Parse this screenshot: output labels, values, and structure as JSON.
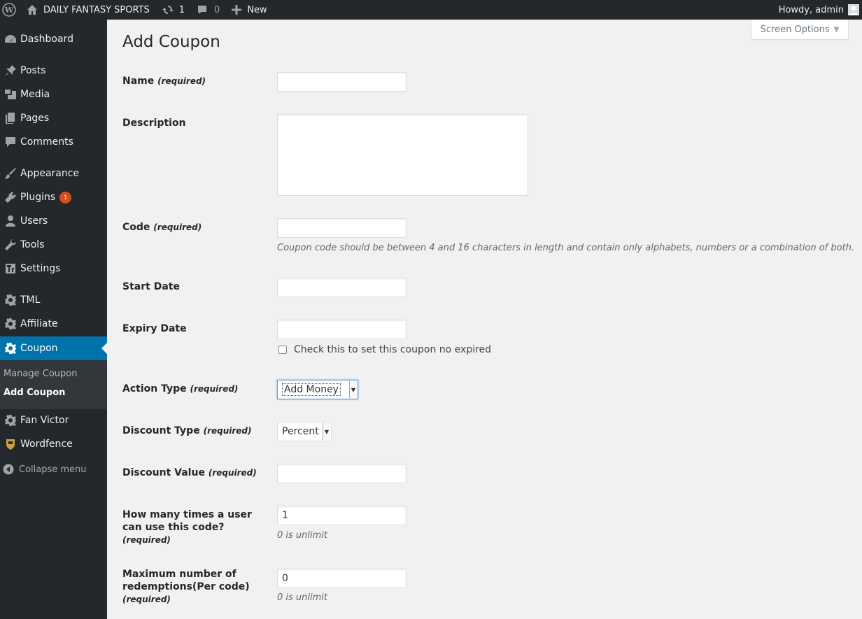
{
  "adminbar": {
    "site_name": "DAILY FANTASY SPORTS",
    "updates_count": "1",
    "comments_count": "0",
    "new_label": "New",
    "howdy": "Howdy, admin"
  },
  "sidebar": {
    "items": [
      {
        "label": "Dashboard",
        "icon": "dashboard-icon"
      },
      {
        "label": "Posts",
        "icon": "pin-icon"
      },
      {
        "label": "Media",
        "icon": "media-icon"
      },
      {
        "label": "Pages",
        "icon": "pages-icon"
      },
      {
        "label": "Comments",
        "icon": "comment-icon"
      },
      {
        "label": "Appearance",
        "icon": "brush-icon"
      },
      {
        "label": "Plugins",
        "icon": "plugin-icon",
        "badge": "1"
      },
      {
        "label": "Users",
        "icon": "user-icon"
      },
      {
        "label": "Tools",
        "icon": "wrench-icon"
      },
      {
        "label": "Settings",
        "icon": "settings-icon"
      },
      {
        "label": "TML",
        "icon": "gear-icon"
      },
      {
        "label": "Affiliate",
        "icon": "gear-icon"
      },
      {
        "label": "Coupon",
        "icon": "gear-icon",
        "current": true
      },
      {
        "label": "Fan Victor",
        "icon": "gear-icon"
      },
      {
        "label": "Wordfence",
        "icon": "wordfence-icon"
      }
    ],
    "submenu": [
      "Manage Coupon",
      "Add Coupon"
    ],
    "collapse_label": "Collapse menu"
  },
  "screen_options": "Screen Options",
  "page_title": "Add Coupon",
  "form": {
    "name_label": "Name",
    "required": "(required)",
    "description_label": "Description",
    "code_label": "Code",
    "code_help": "Coupon code should be between 4 and 16 characters in length and contain only alphabets, numbers or a combination of both.",
    "start_date_label": "Start Date",
    "expiry_date_label": "Expiry Date",
    "no_expire_label": "Check this to set this coupon no expired",
    "action_type_label": "Action Type",
    "action_type_value": "Add Money",
    "discount_type_label": "Discount Type",
    "discount_type_value": "Percent",
    "discount_value_label": "Discount Value",
    "uses_per_user_label": "How many times a user can use this code?",
    "uses_per_user_value": "1",
    "uses_per_user_help": "0 is unlimit",
    "max_redemptions_label": "Maximum number of redemptions(Per code)",
    "max_redemptions_value": "0",
    "max_redemptions_help": "0 is unlimit"
  }
}
